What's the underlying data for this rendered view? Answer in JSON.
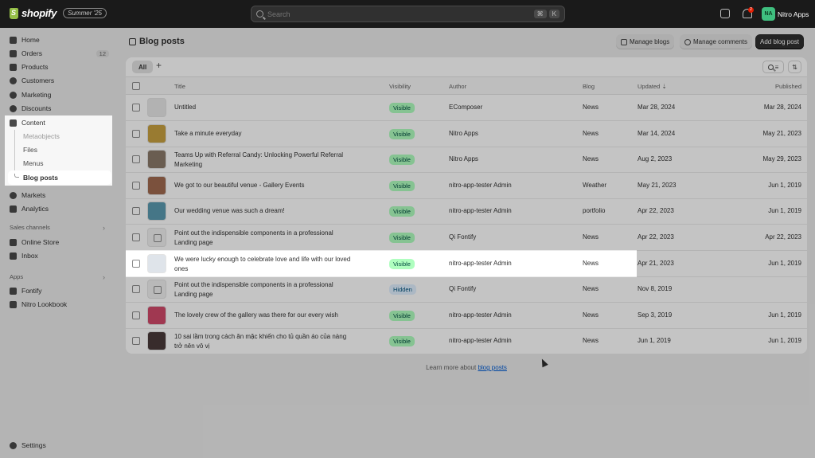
{
  "topbar": {
    "logo_text": "shopify",
    "badge": "Summer '25",
    "search_placeholder": "Search",
    "shortcut_1": "⌘",
    "shortcut_2": "K",
    "notifications_count": "2",
    "avatar_initials": "NA",
    "account_name": "Nitro Apps"
  },
  "sidebar": {
    "items": [
      {
        "label": "Home",
        "icon": "home-icon"
      },
      {
        "label": "Orders",
        "icon": "orders-icon",
        "count": "12"
      },
      {
        "label": "Products",
        "icon": "tag-icon"
      },
      {
        "label": "Customers",
        "icon": "person-icon"
      },
      {
        "label": "Marketing",
        "icon": "target-icon"
      },
      {
        "label": "Discounts",
        "icon": "discount-icon"
      },
      {
        "label": "Content",
        "icon": "content-icon"
      }
    ],
    "content_sub": {
      "metaobjects": "Metaobjects",
      "files": "Files",
      "menus": "Menus",
      "blog_posts": "Blog posts"
    },
    "items_2": [
      {
        "label": "Markets",
        "icon": "globe-icon"
      },
      {
        "label": "Analytics",
        "icon": "chart-icon"
      }
    ],
    "sales_channels_label": "Sales channels",
    "sales_channels": [
      {
        "label": "Online Store",
        "icon": "store-icon"
      },
      {
        "label": "Inbox",
        "icon": "inbox-icon"
      }
    ],
    "apps_label": "Apps",
    "apps": [
      {
        "label": "Fontify",
        "icon": "app-icon"
      },
      {
        "label": "Nitro Lookbook",
        "icon": "app-icon"
      }
    ],
    "settings": "Settings"
  },
  "page": {
    "title": "Blog posts",
    "manage_blogs": "Manage blogs",
    "manage_comments": "Manage comments",
    "add_blog_post": "Add blog post",
    "tab_all": "All",
    "tab_add": "+"
  },
  "table": {
    "headers": {
      "title": "Title",
      "visibility": "Visibility",
      "author": "Author",
      "blog": "Blog",
      "updated": "Updated",
      "sort_indicator": "⇣",
      "published": "Published"
    },
    "rows": [
      {
        "title_1": "Untitled",
        "title_2": "",
        "visibility": "Visible",
        "author": "EComposer",
        "blog": "News",
        "updated": "Mar 28, 2024",
        "published": "Mar 28, 2024",
        "thumb": "#e8e8e8"
      },
      {
        "title_1": "Take a minute everyday",
        "title_2": "",
        "visibility": "Visible",
        "author": "Nitro Apps",
        "blog": "News",
        "updated": "Mar 14, 2024",
        "published": "May 21, 2023",
        "thumb": "#c8a040"
      },
      {
        "title_1": "Teams Up with Referral Candy: Unlocking Powerful Referral",
        "title_2": "Marketing",
        "visibility": "Visible",
        "author": "Nitro Apps",
        "blog": "News",
        "updated": "Aug 2, 2023",
        "published": "May 29, 2023",
        "thumb": "#8a7a6a"
      },
      {
        "title_1": "We got to our beautiful venue - Gallery Events",
        "title_2": "",
        "visibility": "Visible",
        "author": "nitro-app-tester Admin",
        "blog": "Weather",
        "updated": "May 21, 2023",
        "published": "Jun 1, 2019",
        "thumb": "#a06a50"
      },
      {
        "title_1": "Our wedding venue was such a dream!",
        "title_2": "",
        "visibility": "Visible",
        "author": "nitro-app-tester Admin",
        "blog": "portfolio",
        "updated": "Apr 22, 2023",
        "published": "Jun 1, 2019",
        "thumb": "#5a9ab0"
      },
      {
        "title_1": "Point out the indispensible components in a professional",
        "title_2": "Landing page",
        "visibility": "Visible",
        "author": "Qi Fontify",
        "blog": "News",
        "updated": "Apr 22, 2023",
        "published": "Apr 22, 2023",
        "thumb": ""
      },
      {
        "title_1": "We were lucky enough to celebrate love and life with our loved",
        "title_2": "ones",
        "visibility": "Visible",
        "author": "nitro-app-tester Admin",
        "blog": "News",
        "updated": "Apr 21, 2023",
        "published": "Jun 1, 2019",
        "thumb": "#dfe4ea"
      },
      {
        "title_1": "Point out the indispensible components in a professional",
        "title_2": "Landing page",
        "visibility": "Hidden",
        "author": "Qi Fontify",
        "blog": "News",
        "updated": "Nov 8, 2019",
        "published": "",
        "thumb": ""
      },
      {
        "title_1": "The lovely crew of the gallery was there for our every wish",
        "title_2": "",
        "visibility": "Visible",
        "author": "nitro-app-tester Admin",
        "blog": "News",
        "updated": "Sep 3, 2019",
        "published": "Jun 1, 2019",
        "thumb": "#d04a6a"
      },
      {
        "title_1": "10 sai lầm trong cách ăn mặc khiến cho tủ quần áo của nàng",
        "title_2": "trở nên vô vị",
        "visibility": "Visible",
        "author": "nitro-app-tester Admin",
        "blog": "News",
        "updated": "Jun 1, 2019",
        "published": "Jun 1, 2019",
        "thumb": "#4a3a3a"
      }
    ]
  },
  "footer": {
    "text": "Learn more about",
    "link": "blog posts"
  }
}
